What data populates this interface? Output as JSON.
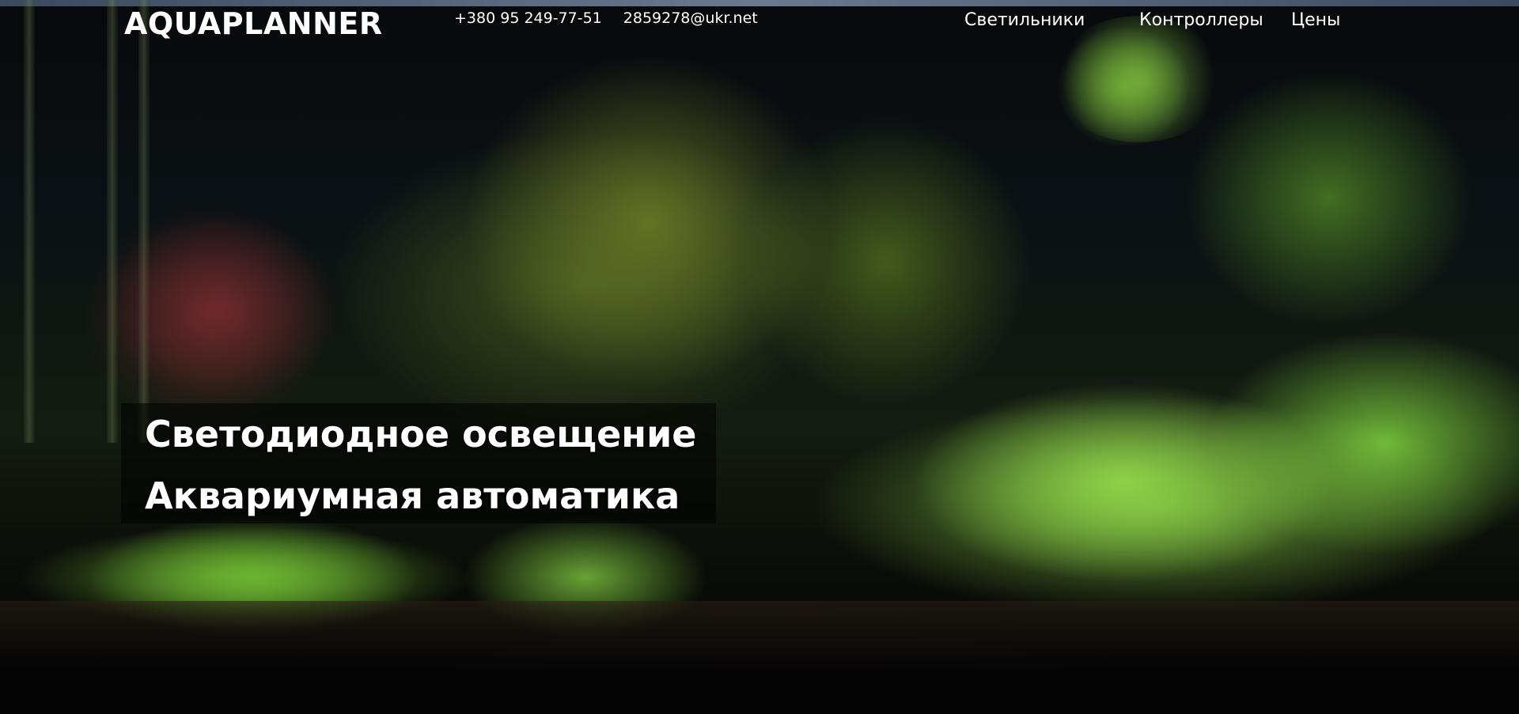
{
  "header": {
    "logo": "AQUAPLANNER",
    "phone": "+380 95 249-77-51",
    "email": "2859278@ukr.net",
    "nav": [
      "Светильники",
      "Контроллеры",
      "Цены"
    ]
  },
  "hero": {
    "lines": [
      "Светодиодное освещение",
      "Аквариумная автоматика"
    ]
  },
  "colors": {
    "text": "#ffffff",
    "overlay": "rgba(0,0,0,0.55)"
  }
}
